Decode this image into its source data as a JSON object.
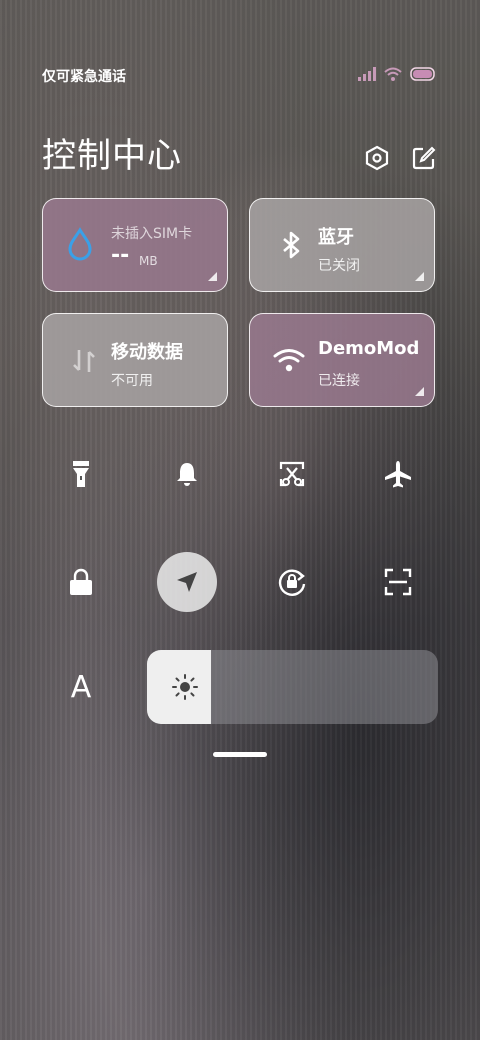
{
  "status": {
    "carrier_text": "仅可紧急通话",
    "icons": [
      "signal-icon",
      "wifi-icon",
      "battery-icon"
    ]
  },
  "header": {
    "title": "控制中心",
    "settings_icon": "settings-hexagon-icon",
    "edit_icon": "edit-icon"
  },
  "tiles": {
    "data_usage": {
      "name": "未插入SIM卡",
      "value": "--",
      "unit": "MB",
      "icon": "water-drop-icon"
    },
    "bluetooth": {
      "name": "蓝牙",
      "status": "已关闭",
      "icon": "bluetooth-icon"
    },
    "mobile_data": {
      "name": "移动数据",
      "status": "不可用",
      "icon": "data-arrows-icon"
    },
    "wifi": {
      "name": "DemoMod",
      "status": "已连接",
      "icon": "wifi-icon"
    }
  },
  "quick_buttons": [
    "flashlight-icon",
    "bell-icon",
    "screenshot-icon",
    "airplane-icon",
    "lock-icon",
    "location-icon",
    "rotation-lock-icon",
    "scan-icon",
    "font-icon"
  ],
  "font_button_label": "A",
  "brightness": {
    "level": 0.22
  },
  "colors": {
    "tile_active": "#96788c",
    "tile_inactive": "#a5a0a0",
    "drop_blue": "#3aa0e8"
  }
}
